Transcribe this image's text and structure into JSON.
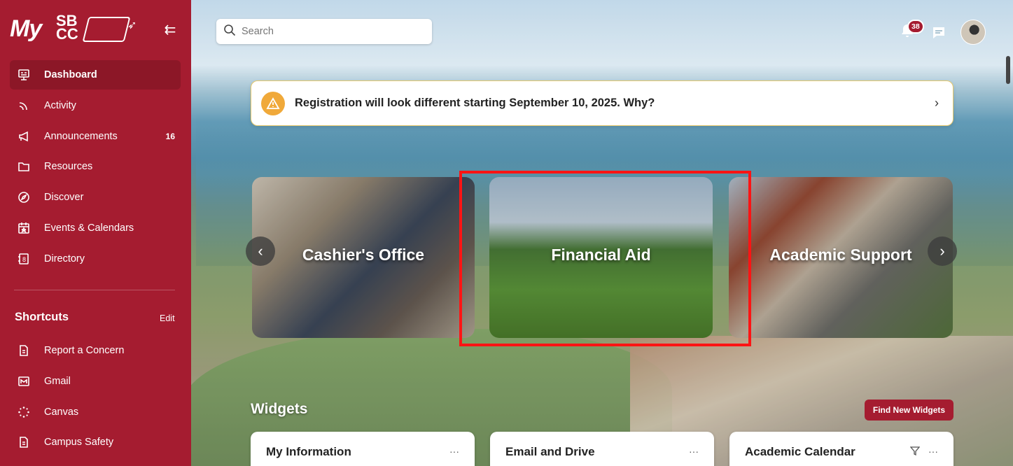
{
  "app": {
    "logo_text_my": "My",
    "logo_text_sbcc": "SB CC"
  },
  "sidebar": {
    "nav": [
      {
        "label": "Dashboard",
        "icon": "dashboard-icon",
        "active": true
      },
      {
        "label": "Activity",
        "icon": "activity-icon"
      },
      {
        "label": "Announcements",
        "icon": "megaphone-icon",
        "badge": "16"
      },
      {
        "label": "Resources",
        "icon": "folder-icon"
      },
      {
        "label": "Discover",
        "icon": "compass-icon"
      },
      {
        "label": "Events & Calendars",
        "icon": "calendar-icon"
      },
      {
        "label": "Directory",
        "icon": "directory-icon"
      }
    ],
    "shortcuts_title": "Shortcuts",
    "shortcuts_edit": "Edit",
    "shortcuts": [
      {
        "label": "Report a Concern",
        "icon": "document-icon"
      },
      {
        "label": "Gmail",
        "icon": "mail-icon"
      },
      {
        "label": "Canvas",
        "icon": "canvas-icon"
      },
      {
        "label": "Campus Safety",
        "icon": "document-icon"
      }
    ]
  },
  "header": {
    "search_placeholder": "Search",
    "notification_count": "38"
  },
  "banner": {
    "text": "Registration will look different starting September 10, 2025. Why?"
  },
  "carousel": {
    "cards": [
      {
        "label": "Cashier's Office"
      },
      {
        "label": "Financial Aid"
      },
      {
        "label": "Academic Support"
      }
    ]
  },
  "widgets": {
    "title": "Widgets",
    "find_button": "Find New Widgets",
    "cards": [
      {
        "title": "My Information"
      },
      {
        "title": "Email and Drive"
      },
      {
        "title": "Academic Calendar"
      }
    ],
    "more_glyph": "···"
  },
  "colors": {
    "brand": "#a51c30",
    "brand_active": "#8c1727",
    "warning": "#f0a93a",
    "highlight": "#ff1414"
  }
}
